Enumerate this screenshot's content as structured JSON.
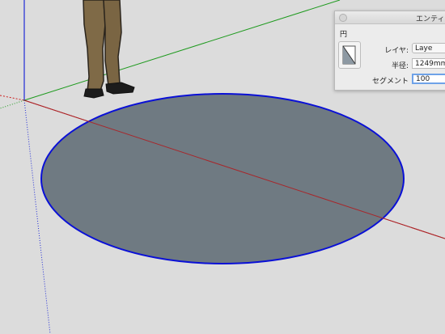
{
  "window": {
    "title": "エンティ"
  },
  "entity": {
    "type": "円"
  },
  "fields": {
    "layer_label": "レイヤ:",
    "layer_value": "Laye",
    "radius_label": "半径:",
    "radius_value": "1249mm",
    "segments_label": "セグメント",
    "segments_value": "100"
  },
  "colors": {
    "background": "#dcdcdc",
    "circle_fill": "#6f7a82",
    "circle_edge": "#0a10d6",
    "axis_red": "#cc1f1f",
    "axis_green": "#1e9a1e",
    "axis_blue": "#1f2ad6"
  },
  "icons": [
    "person-figure",
    "circle-entity-icon"
  ]
}
